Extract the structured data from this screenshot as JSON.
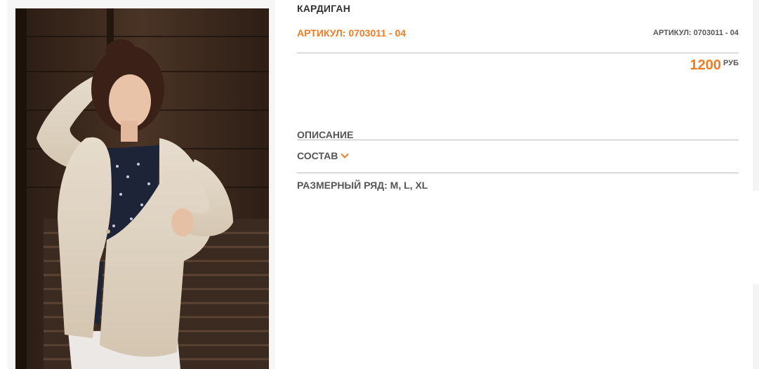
{
  "product": {
    "title": "КАРДИГАН",
    "sku_main": "АРТИКУЛ: 0703011 - 04",
    "sku_small": "АРТИКУЛ: 0703011 - 04",
    "price": "1200",
    "currency": "РУБ"
  },
  "sections": {
    "description": "ОПИСАНИЕ",
    "composition": "СОСТАВ",
    "sizes": "РАЗМЕРНЫЙ РЯД: M, L, XL"
  },
  "icons": {
    "composition_toggle": "chevron-down-icon"
  },
  "colors": {
    "accent": "#f07b25",
    "text": "#555555",
    "divider": "#bdbdbd"
  }
}
